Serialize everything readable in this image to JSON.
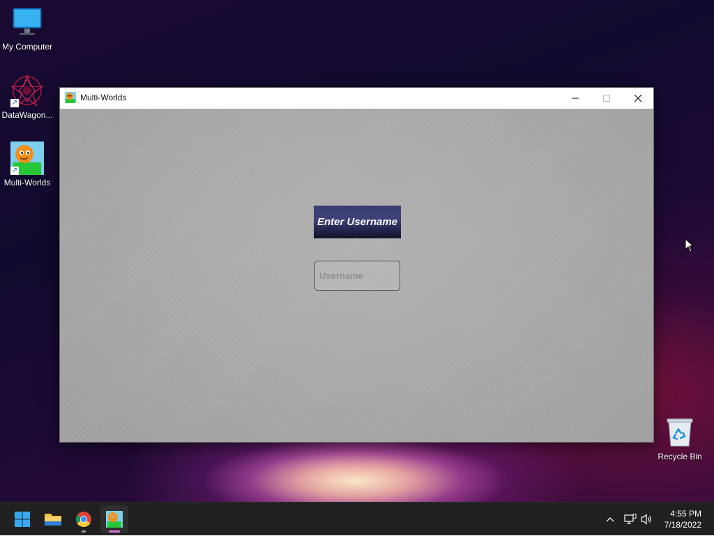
{
  "desktop": {
    "icons": [
      {
        "label": "My Computer",
        "icon": "monitor-icon"
      },
      {
        "label": "DataWagon...",
        "icon": "datawagon-icon"
      },
      {
        "label": "Multi-Worlds",
        "icon": "multi-worlds-icon"
      },
      {
        "label": "Recycle Bin",
        "icon": "recycle-bin-icon"
      }
    ]
  },
  "window": {
    "title": "Multi-Worlds",
    "controls": {
      "minimize": "minimize-icon",
      "maximize": "maximize-icon",
      "close": "close-icon"
    },
    "enter_label": "Enter Username",
    "username": {
      "value": "",
      "placeholder": "Username"
    }
  },
  "taskbar": {
    "apps": [
      "start-icon",
      "file-explorer-icon",
      "chrome-icon",
      "multi-worlds-icon"
    ],
    "tray": [
      "chevron-up-icon",
      "network-icon",
      "volume-icon"
    ],
    "clock": {
      "time": "4:55 PM",
      "date": "7/18/2022"
    }
  },
  "colors": {
    "taskbar": "#202020",
    "label_bg": "#2f3266",
    "window_bg": "#a9a9a9"
  }
}
